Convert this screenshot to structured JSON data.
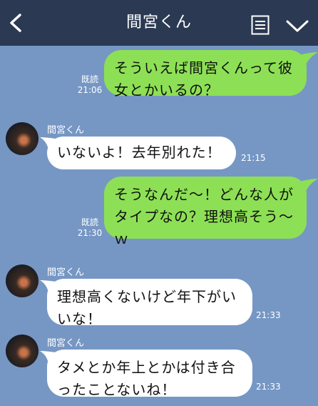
{
  "header": {
    "title": "間宮くん"
  },
  "messages": [
    {
      "from": "me",
      "text": "そういえば間宮くんって彼女とかいるの？",
      "read": "既読",
      "time": "21:06"
    },
    {
      "from": "them",
      "sender": "間宮くん",
      "text": "いないよ！去年別れた！",
      "time": "21:15"
    },
    {
      "from": "me",
      "text": "そうなんだ〜！どんな人がタイプなの？理想高そう〜ｗ",
      "read": "既読",
      "time": "21:30"
    },
    {
      "from": "them",
      "sender": "間宮くん",
      "text": "理想高くないけど年下がいいな！",
      "time": "21:33"
    },
    {
      "from": "them",
      "sender": "間宮くん",
      "text": "タメとか年上とかは付き合ったことないね！",
      "time": "21:33"
    }
  ],
  "colors": {
    "background": "#7697c4",
    "header": "#2b3a52",
    "my_bubble": "#8de055",
    "their_bubble": "#ffffff"
  }
}
